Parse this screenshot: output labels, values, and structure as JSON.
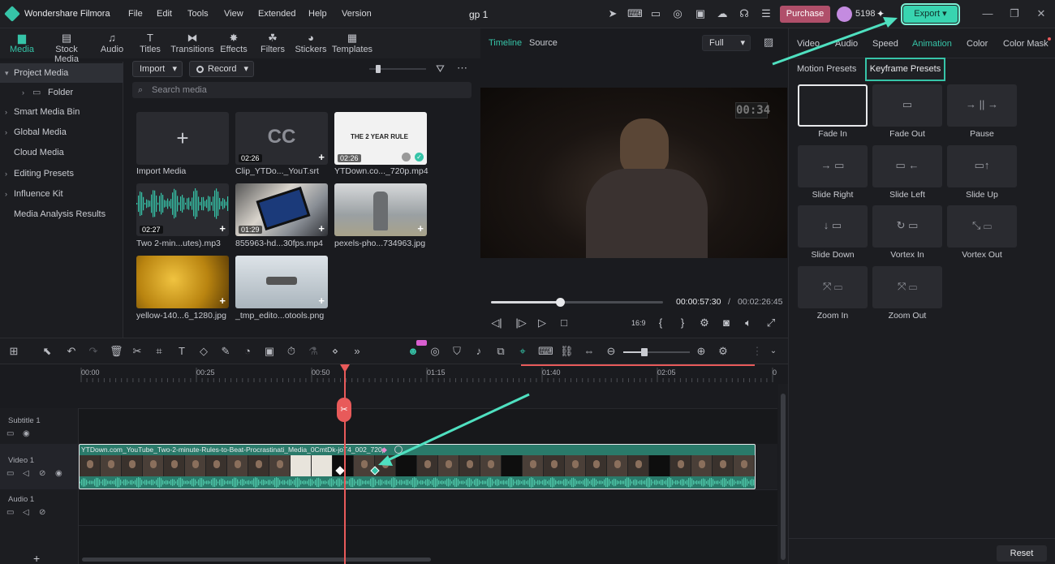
{
  "app": {
    "name": "Wondershare Filmora",
    "project": "gp 1",
    "credits": "5198",
    "purchase": "Purchase",
    "export": "Export"
  },
  "menu": [
    "File",
    "Edit",
    "Tools",
    "View",
    "Extended",
    "Help",
    "Version"
  ],
  "media_tabs": [
    {
      "label": "Media",
      "icon": "media-icon"
    },
    {
      "label": "Stock Media",
      "icon": "stock-media-icon"
    },
    {
      "label": "Audio",
      "icon": "audio-icon"
    },
    {
      "label": "Titles",
      "icon": "titles-icon"
    },
    {
      "label": "Transitions",
      "icon": "transitions-icon"
    },
    {
      "label": "Effects",
      "icon": "effects-icon"
    },
    {
      "label": "Filters",
      "icon": "filters-icon"
    },
    {
      "label": "Stickers",
      "icon": "stickers-icon"
    },
    {
      "label": "Templates",
      "icon": "templates-icon"
    }
  ],
  "nav": [
    "Project Media",
    "Folder",
    "Smart Media Bin",
    "Global Media",
    "Cloud Media",
    "Editing Presets",
    "Influence Kit",
    "Media Analysis Results"
  ],
  "media_toolbar": {
    "import": "Import",
    "record": "Record",
    "search_placeholder": "Search media"
  },
  "media_items": [
    {
      "label": "Import Media",
      "duration": ""
    },
    {
      "label": "Clip_YTDo..._YouT.srt",
      "duration": "02:26"
    },
    {
      "label": "YTDown.co..._720p.mp4",
      "duration": "02:26",
      "thumb_text": "THE 2 YEAR RULE"
    },
    {
      "label": "Two 2-min...utes).mp3",
      "duration": "02:27"
    },
    {
      "label": "855963-hd...30fps.mp4",
      "duration": "01:29"
    },
    {
      "label": "pexels-pho...734963.jpg",
      "duration": ""
    },
    {
      "label": "yellow-140...6_1280.jpg",
      "duration": ""
    },
    {
      "label": "_tmp_edito...otools.png",
      "duration": ""
    }
  ],
  "preview": {
    "tab_timeline": "Timeline",
    "tab_source": "Source",
    "zoom": "Full",
    "current": "00:00:57:30",
    "sep": "/",
    "total": "00:02:26:45",
    "overlay_time": "00:34",
    "progress": 0.4
  },
  "right_tabs": [
    "Video",
    "Audio",
    "Speed",
    "Animation",
    "Color",
    "Color Mask"
  ],
  "anim_subtabs": [
    "Motion Presets",
    "Keyframe Presets"
  ],
  "presets": [
    "Fade In",
    "Fade Out",
    "Pause",
    "Slide Right",
    "Slide Left",
    "Slide Up",
    "Slide Down",
    "Vortex In",
    "Vortex Out",
    "Zoom In",
    "Zoom Out"
  ],
  "reset": "Reset",
  "ruler": [
    "00:00",
    "00:25",
    "00:50",
    "01:15",
    "01:40",
    "02:05",
    "0"
  ],
  "tracks": [
    "Subtitle 1",
    "Video 1",
    "Audio 1"
  ],
  "clip_title": "YTDown.com_YouTube_Two-2-minute-Rules-to-Beat-Procrastinati_Media_0CmtDk-joT4_002_720p",
  "colors": {
    "accent": "#36c4a8",
    "playhead": "#e85a5a",
    "purchase": "#b04f6a",
    "clip": "#2a7a6a"
  }
}
